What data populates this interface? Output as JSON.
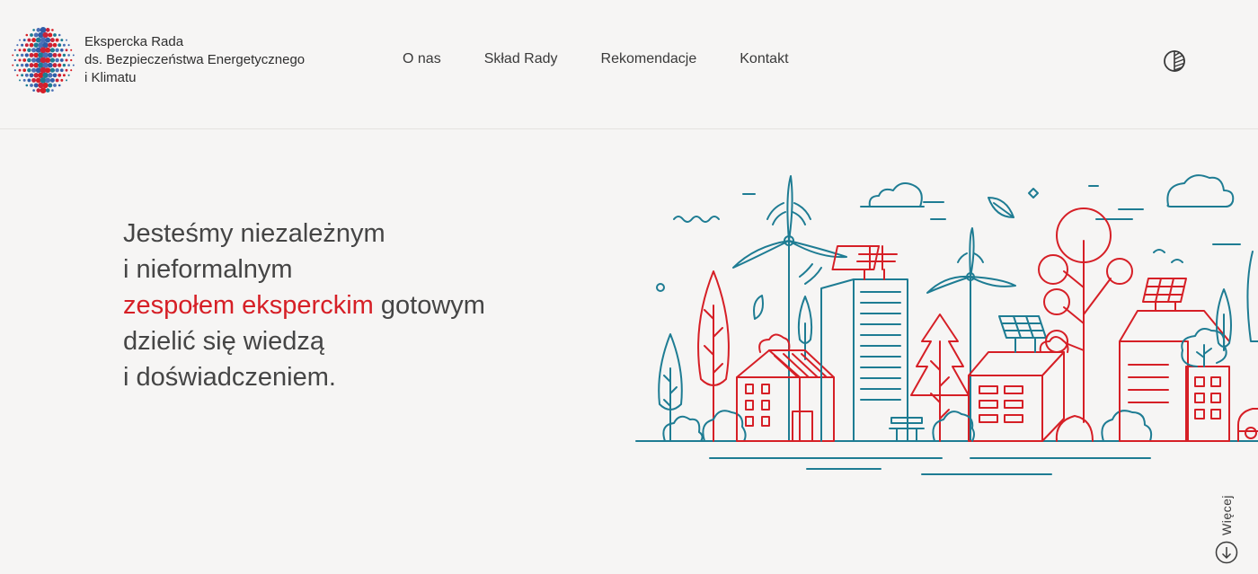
{
  "brand": {
    "line1": "Ekspercka Rada",
    "line2": "ds. Bezpieczeństwa Energetycznego",
    "line3": "i Klimatu"
  },
  "nav": {
    "items": [
      {
        "label": "O nas"
      },
      {
        "label": "Skład Rady"
      },
      {
        "label": "Rekomendacje"
      },
      {
        "label": "Kontakt"
      }
    ]
  },
  "hero": {
    "line1": "Jesteśmy niezależnym",
    "line2": "i nieformalnym",
    "line3_accent": "zespołem eksperckim",
    "line3_rest": " gotowym",
    "line4": "dzielić się wiedzą",
    "line5": "i doświadczeniem."
  },
  "scroll": {
    "label": "Więcej"
  },
  "icons": {
    "theme": "contrast-toggle-icon",
    "scroll": "arrow-down-circle-icon",
    "logo": "dotted-globe-icon"
  },
  "colors": {
    "accent": "#d61f26",
    "teal": "#1e7c93",
    "background": "#f6f5f4",
    "text": "#454545"
  }
}
